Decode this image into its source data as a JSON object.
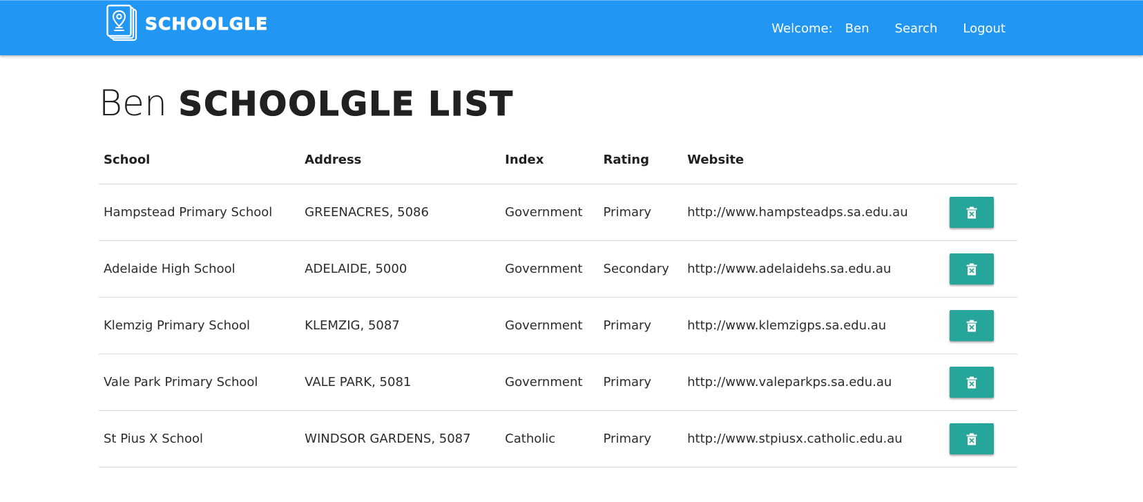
{
  "nav": {
    "brand": "SCHOOLGLE",
    "brand_icon": "map-pin-icon",
    "welcome_label": "Welcome:",
    "user_name": "Ben",
    "search_label": "Search",
    "logout_label": "Logout",
    "color": "#2196f3"
  },
  "page": {
    "title_user": "Ben",
    "title_brand": "SCHOOLGLE LIST"
  },
  "table": {
    "headers": [
      "School",
      "Address",
      "Index",
      "Rating",
      "Website"
    ],
    "rows": [
      {
        "school": "Hampstead Primary School",
        "address": "GREENACRES, 5086",
        "index": "Government",
        "rating": "Primary",
        "website": "http://www.hampsteadps.sa.edu.au"
      },
      {
        "school": "Adelaide High School",
        "address": "ADELAIDE, 5000",
        "index": "Government",
        "rating": "Secondary",
        "website": "http://www.adelaidehs.sa.edu.au"
      },
      {
        "school": "Klemzig Primary School",
        "address": "KLEMZIG, 5087",
        "index": "Government",
        "rating": "Primary",
        "website": "http://www.klemzigps.sa.edu.au"
      },
      {
        "school": "Vale Park Primary School",
        "address": "VALE PARK, 5081",
        "index": "Government",
        "rating": "Primary",
        "website": "http://www.valeparkps.sa.edu.au"
      },
      {
        "school": "St Pius X School",
        "address": "WINDSOR GARDENS, 5087",
        "index": "Catholic",
        "rating": "Primary",
        "website": "http://www.stpiusx.catholic.edu.au"
      }
    ],
    "delete_icon": "trash-x-icon",
    "delete_button_color": "#26a69a"
  }
}
